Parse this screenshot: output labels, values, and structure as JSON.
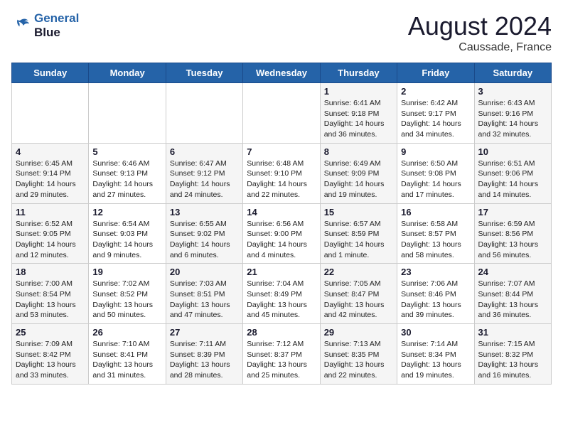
{
  "header": {
    "logo_line1": "General",
    "logo_line2": "Blue",
    "month_year": "August 2024",
    "location": "Caussade, France"
  },
  "weekdays": [
    "Sunday",
    "Monday",
    "Tuesday",
    "Wednesday",
    "Thursday",
    "Friday",
    "Saturday"
  ],
  "weeks": [
    [
      {
        "day": "",
        "info": ""
      },
      {
        "day": "",
        "info": ""
      },
      {
        "day": "",
        "info": ""
      },
      {
        "day": "",
        "info": ""
      },
      {
        "day": "1",
        "info": "Sunrise: 6:41 AM\nSunset: 9:18 PM\nDaylight: 14 hours\nand 36 minutes."
      },
      {
        "day": "2",
        "info": "Sunrise: 6:42 AM\nSunset: 9:17 PM\nDaylight: 14 hours\nand 34 minutes."
      },
      {
        "day": "3",
        "info": "Sunrise: 6:43 AM\nSunset: 9:16 PM\nDaylight: 14 hours\nand 32 minutes."
      }
    ],
    [
      {
        "day": "4",
        "info": "Sunrise: 6:45 AM\nSunset: 9:14 PM\nDaylight: 14 hours\nand 29 minutes."
      },
      {
        "day": "5",
        "info": "Sunrise: 6:46 AM\nSunset: 9:13 PM\nDaylight: 14 hours\nand 27 minutes."
      },
      {
        "day": "6",
        "info": "Sunrise: 6:47 AM\nSunset: 9:12 PM\nDaylight: 14 hours\nand 24 minutes."
      },
      {
        "day": "7",
        "info": "Sunrise: 6:48 AM\nSunset: 9:10 PM\nDaylight: 14 hours\nand 22 minutes."
      },
      {
        "day": "8",
        "info": "Sunrise: 6:49 AM\nSunset: 9:09 PM\nDaylight: 14 hours\nand 19 minutes."
      },
      {
        "day": "9",
        "info": "Sunrise: 6:50 AM\nSunset: 9:08 PM\nDaylight: 14 hours\nand 17 minutes."
      },
      {
        "day": "10",
        "info": "Sunrise: 6:51 AM\nSunset: 9:06 PM\nDaylight: 14 hours\nand 14 minutes."
      }
    ],
    [
      {
        "day": "11",
        "info": "Sunrise: 6:52 AM\nSunset: 9:05 PM\nDaylight: 14 hours\nand 12 minutes."
      },
      {
        "day": "12",
        "info": "Sunrise: 6:54 AM\nSunset: 9:03 PM\nDaylight: 14 hours\nand 9 minutes."
      },
      {
        "day": "13",
        "info": "Sunrise: 6:55 AM\nSunset: 9:02 PM\nDaylight: 14 hours\nand 6 minutes."
      },
      {
        "day": "14",
        "info": "Sunrise: 6:56 AM\nSunset: 9:00 PM\nDaylight: 14 hours\nand 4 minutes."
      },
      {
        "day": "15",
        "info": "Sunrise: 6:57 AM\nSunset: 8:59 PM\nDaylight: 14 hours\nand 1 minute."
      },
      {
        "day": "16",
        "info": "Sunrise: 6:58 AM\nSunset: 8:57 PM\nDaylight: 13 hours\nand 58 minutes."
      },
      {
        "day": "17",
        "info": "Sunrise: 6:59 AM\nSunset: 8:56 PM\nDaylight: 13 hours\nand 56 minutes."
      }
    ],
    [
      {
        "day": "18",
        "info": "Sunrise: 7:00 AM\nSunset: 8:54 PM\nDaylight: 13 hours\nand 53 minutes."
      },
      {
        "day": "19",
        "info": "Sunrise: 7:02 AM\nSunset: 8:52 PM\nDaylight: 13 hours\nand 50 minutes."
      },
      {
        "day": "20",
        "info": "Sunrise: 7:03 AM\nSunset: 8:51 PM\nDaylight: 13 hours\nand 47 minutes."
      },
      {
        "day": "21",
        "info": "Sunrise: 7:04 AM\nSunset: 8:49 PM\nDaylight: 13 hours\nand 45 minutes."
      },
      {
        "day": "22",
        "info": "Sunrise: 7:05 AM\nSunset: 8:47 PM\nDaylight: 13 hours\nand 42 minutes."
      },
      {
        "day": "23",
        "info": "Sunrise: 7:06 AM\nSunset: 8:46 PM\nDaylight: 13 hours\nand 39 minutes."
      },
      {
        "day": "24",
        "info": "Sunrise: 7:07 AM\nSunset: 8:44 PM\nDaylight: 13 hours\nand 36 minutes."
      }
    ],
    [
      {
        "day": "25",
        "info": "Sunrise: 7:09 AM\nSunset: 8:42 PM\nDaylight: 13 hours\nand 33 minutes."
      },
      {
        "day": "26",
        "info": "Sunrise: 7:10 AM\nSunset: 8:41 PM\nDaylight: 13 hours\nand 31 minutes."
      },
      {
        "day": "27",
        "info": "Sunrise: 7:11 AM\nSunset: 8:39 PM\nDaylight: 13 hours\nand 28 minutes."
      },
      {
        "day": "28",
        "info": "Sunrise: 7:12 AM\nSunset: 8:37 PM\nDaylight: 13 hours\nand 25 minutes."
      },
      {
        "day": "29",
        "info": "Sunrise: 7:13 AM\nSunset: 8:35 PM\nDaylight: 13 hours\nand 22 minutes."
      },
      {
        "day": "30",
        "info": "Sunrise: 7:14 AM\nSunset: 8:34 PM\nDaylight: 13 hours\nand 19 minutes."
      },
      {
        "day": "31",
        "info": "Sunrise: 7:15 AM\nSunset: 8:32 PM\nDaylight: 13 hours\nand 16 minutes."
      }
    ]
  ]
}
